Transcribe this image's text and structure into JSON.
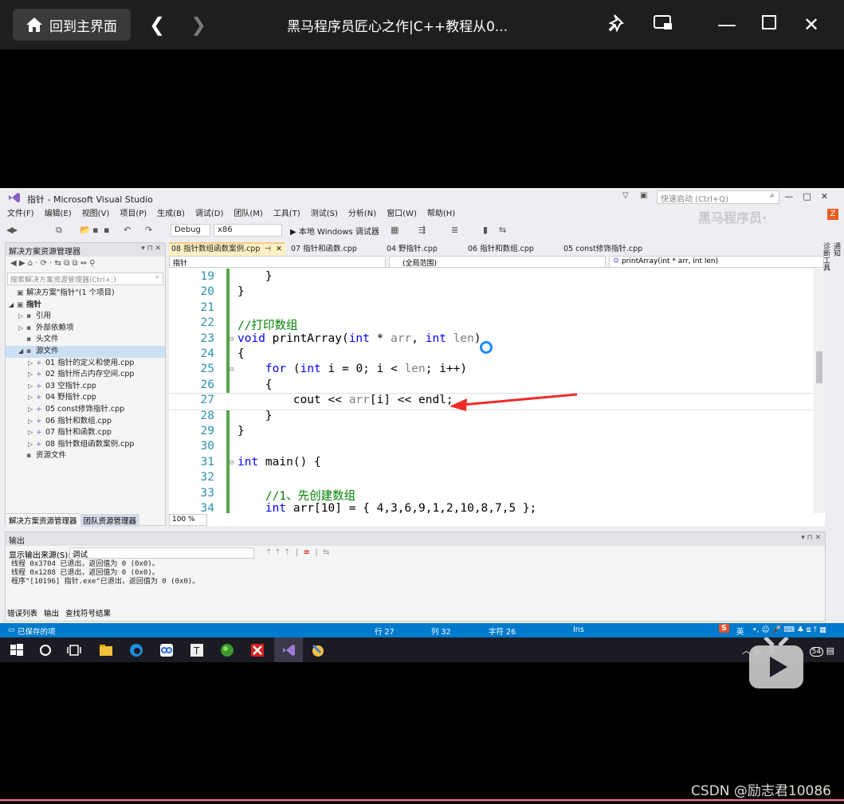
{
  "player": {
    "home_label": "回到主界面",
    "title": "黑马程序员匠心之作|C++教程从0..."
  },
  "vs": {
    "window_title": "指针 - Microsoft Visual Studio",
    "quick_launch_placeholder": "快速启动 (Ctrl+Q)",
    "menu": [
      "文件(F)",
      "编辑(E)",
      "视图(V)",
      "项目(P)",
      "生成(B)",
      "调试(D)",
      "团队(M)",
      "工具(T)",
      "测试(S)",
      "分析(N)",
      "窗口(W)",
      "帮助(H)"
    ],
    "toolbar": {
      "config": "Debug",
      "platform": "x86",
      "run_label": "▶ 本地 Windows 调试器"
    },
    "watermark": "黑马程序员·",
    "solution_explorer": {
      "title": "解决方案资源管理器",
      "search_placeholder": "搜索解决方案资源管理器(Ctrl+;)",
      "tree": [
        {
          "indent": 0,
          "label": "解决方案\"指针\"(1 个项目)",
          "tri": "",
          "ico": "▣"
        },
        {
          "indent": 0,
          "label": "指针",
          "tri": "◢",
          "ico": "▣",
          "bold": true
        },
        {
          "indent": 1,
          "label": "引用",
          "tri": "▷",
          "ico": "▪"
        },
        {
          "indent": 1,
          "label": "外部依赖项",
          "tri": "▷",
          "ico": "▪"
        },
        {
          "indent": 1,
          "label": "头文件",
          "tri": "",
          "ico": "▪"
        },
        {
          "indent": 1,
          "label": "源文件",
          "tri": "◢",
          "ico": "▪",
          "selected": true
        },
        {
          "indent": 2,
          "label": "01 指针的定义和使用.cpp",
          "tri": "▷",
          "ico": "+"
        },
        {
          "indent": 2,
          "label": "02 指针所占内存空间.cpp",
          "tri": "▷",
          "ico": "+"
        },
        {
          "indent": 2,
          "label": "03 空指针.cpp",
          "tri": "▷",
          "ico": "+"
        },
        {
          "indent": 2,
          "label": "04 野指针.cpp",
          "tri": "▷",
          "ico": "+"
        },
        {
          "indent": 2,
          "label": "05 const修饰指针.cpp",
          "tri": "▷",
          "ico": "+"
        },
        {
          "indent": 2,
          "label": "06 指针和数组.cpp",
          "tri": "▷",
          "ico": "+"
        },
        {
          "indent": 2,
          "label": "07 指针和函数.cpp",
          "tri": "▷",
          "ico": "+"
        },
        {
          "indent": 2,
          "label": "08 指针数组函数案例.cpp",
          "tri": "▷",
          "ico": "+"
        },
        {
          "indent": 1,
          "label": "资源文件",
          "tri": "",
          "ico": "▪"
        }
      ],
      "tabs": [
        "解决方案资源管理器",
        "团队资源管理器"
      ]
    },
    "doc_tabs": [
      "08 指针数组函数案例.cpp",
      "07 指针和函数.cpp",
      "04 野指针.cpp",
      "06 指针和数组.cpp",
      "05 const修饰指针.cpp"
    ],
    "nav": {
      "project": "指针",
      "scope": "(全局范围)",
      "member": "printArray(int * arr, int len)"
    },
    "code_lines": [
      {
        "n": "19",
        "html": "    }"
      },
      {
        "n": "20",
        "html": "}"
      },
      {
        "n": "21",
        "html": ""
      },
      {
        "n": "22",
        "html": "<span class='cm'>//打印数组</span>"
      },
      {
        "n": "23",
        "html": "<span class='kw'>void</span> printArray(<span class='kw'>int</span> * <span class='gr'>arr</span>, <span class='kw'>int</span> <span class='gr'>len</span>)"
      },
      {
        "n": "24",
        "html": "{"
      },
      {
        "n": "25",
        "html": "    <span class='kw'>for</span> (<span class='kw'>int</span> i = 0; i &lt; <span class='gr'>len</span>; i++)"
      },
      {
        "n": "26",
        "html": "    {"
      },
      {
        "n": "27",
        "html": "        cout &lt;&lt; <span class='gr'>arr</span>[i] &lt;&lt; endl;"
      },
      {
        "n": "28",
        "html": "    }"
      },
      {
        "n": "29",
        "html": "}"
      },
      {
        "n": "30",
        "html": ""
      },
      {
        "n": "31",
        "html": "<span class='kw'>int</span> main() {"
      },
      {
        "n": "32",
        "html": ""
      },
      {
        "n": "33",
        "html": "    <span class='cm'>//1、先创建数组</span>"
      },
      {
        "n": "34",
        "html": "    <span class='kw'>int</span> arr[10] = { 4,3,6,9,1,2,10,8,7,5 };"
      }
    ],
    "zoom": "100 %",
    "output": {
      "title": "输出",
      "source_label": "显示输出来源(S):",
      "source_value": "调试",
      "lines": [
        "线程 0x3704 已退出，返回值为 0 (0x0)。",
        "线程 0x1288 已退出，返回值为 0 (0x0)。",
        "程序\"[10196] 指针.exe\"已退出，返回值为 0 (0x0)。"
      ]
    },
    "bottom_tabs": [
      "错误列表",
      "输出",
      "查找符号结果"
    ],
    "status": {
      "message": "已保存的项",
      "row": "行 27",
      "col": "列 32",
      "char": "字符 26",
      "mode": "Ins"
    },
    "side_tabs": [
      "通知",
      "诊断工具"
    ]
  },
  "taskbar": {
    "tray_time": "54",
    "ime": "英"
  },
  "csdn_watermark": "CSDN @励志君10086"
}
